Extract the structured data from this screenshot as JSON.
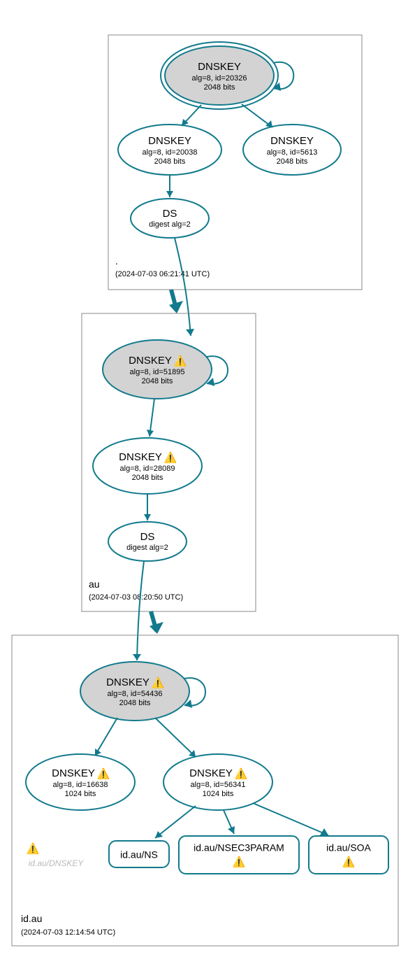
{
  "zones": {
    "root": {
      "name": ".",
      "timestamp": "(2024-07-03 06:21:41 UTC)",
      "ksk": {
        "title": "DNSKEY",
        "alg_id": "alg=8, id=20326",
        "bits": "2048 bits",
        "warn": false
      },
      "zsk1": {
        "title": "DNSKEY",
        "alg_id": "alg=8, id=20038",
        "bits": "2048 bits",
        "warn": false
      },
      "zsk2": {
        "title": "DNSKEY",
        "alg_id": "alg=8, id=5613",
        "bits": "2048 bits",
        "warn": false
      },
      "ds": {
        "title": "DS",
        "sub": "digest alg=2"
      }
    },
    "au": {
      "name": "au",
      "timestamp": "(2024-07-03 08:20:50 UTC)",
      "ksk": {
        "title": "DNSKEY",
        "alg_id": "alg=8, id=51895",
        "bits": "2048 bits",
        "warn": true
      },
      "zsk": {
        "title": "DNSKEY",
        "alg_id": "alg=8, id=28089",
        "bits": "2048 bits",
        "warn": true
      },
      "ds": {
        "title": "DS",
        "sub": "digest alg=2"
      }
    },
    "idau": {
      "name": "id.au",
      "timestamp": "(2024-07-03 12:14:54 UTC)",
      "ksk": {
        "title": "DNSKEY",
        "alg_id": "alg=8, id=54436",
        "bits": "2048 bits",
        "warn": true
      },
      "zsk1": {
        "title": "DNSKEY",
        "alg_id": "alg=8, id=16638",
        "bits": "1024 bits",
        "warn": true
      },
      "zsk2": {
        "title": "DNSKEY",
        "alg_id": "alg=8, id=56341",
        "bits": "1024 bits",
        "warn": true
      },
      "ghost": "id.au/DNSKEY",
      "rr": {
        "ns": {
          "label": "id.au/NS",
          "warn": false
        },
        "nsec3param": {
          "label": "id.au/NSEC3PARAM",
          "warn": true
        },
        "soa": {
          "label": "id.au/SOA",
          "warn": true
        }
      }
    }
  },
  "warn_glyph": "⚠️"
}
